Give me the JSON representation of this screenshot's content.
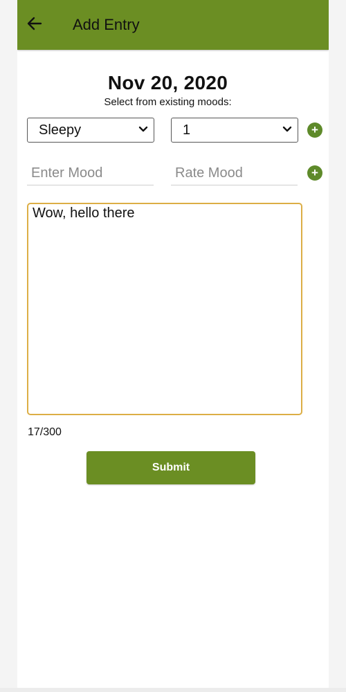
{
  "header": {
    "title": "Add Entry",
    "back_icon": "arrow-left-icon"
  },
  "entry": {
    "date": "Nov 20, 2020",
    "select_hint": "Select from existing moods:"
  },
  "mood_select": {
    "selected": "Sleepy",
    "icon": "chevron-down-icon"
  },
  "rate_select": {
    "selected": "1",
    "icon": "chevron-down-icon"
  },
  "mood_input": {
    "placeholder": "Enter Mood",
    "value": ""
  },
  "rate_input": {
    "placeholder": "Rate Mood",
    "value": ""
  },
  "journal": {
    "text": "Wow, hello there ",
    "counter": "17/300"
  },
  "submit": {
    "label": "Submit"
  },
  "colors": {
    "accent": "#6b8e23",
    "plus_icon": "#5e8a2a",
    "textarea_focus_border": "#dcae45"
  }
}
